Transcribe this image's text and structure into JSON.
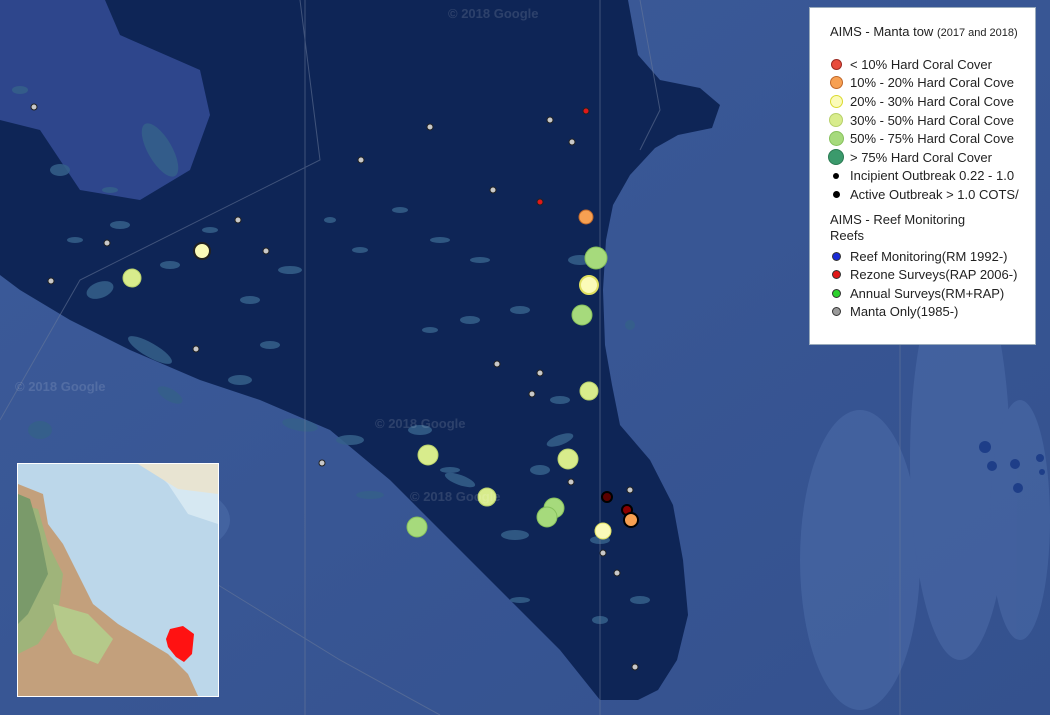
{
  "map": {
    "watermark": "© 2018 Google"
  },
  "legend": {
    "title_main": "AIMS - Manta tow",
    "title_sub": "(2017 and 2018)",
    "manta_items": [
      {
        "label": "< 10% Hard Coral Cover",
        "color": "#e84b3c"
      },
      {
        "label": "10% - 20% Hard Coral Cove",
        "color": "#f7a052"
      },
      {
        "label": "20% - 30% Hard Coral Cove",
        "color": "#fbfbb8"
      },
      {
        "label": "30% - 50% Hard Coral Cove",
        "color": "#d8ec8c"
      },
      {
        "label": "50% - 75% Hard Coral Cove",
        "color": "#a6da7c"
      },
      {
        "label": "> 75% Hard Coral Cover",
        "color": "#3b9a6c"
      },
      {
        "label": "Incipient Outbreak 0.22 - 1.0",
        "color": "#000000"
      },
      {
        "label": "Active Outbreak > 1.0 COTS/",
        "color": "#000000"
      }
    ],
    "section2_title": "AIMS - Reef Monitoring Reefs",
    "reef_items": [
      {
        "label": "Reef Monitoring(RM 1992-)",
        "color": "#1a2bd6"
      },
      {
        "label": "Rezone Surveys(RAP 2006-)",
        "color": "#e01818"
      },
      {
        "label": "Annual Surveys(RM+RAP)",
        "color": "#2dd12d"
      },
      {
        "label": "Manta Only(1985-)",
        "color": "#9a9a9a"
      }
    ]
  }
}
